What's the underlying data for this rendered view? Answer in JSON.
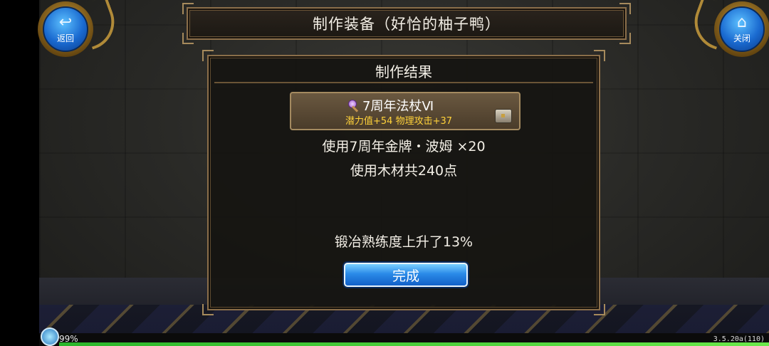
{
  "header": {
    "title": "制作装备（好恰的柚子鸭）",
    "back_label": "返回",
    "close_label": "关闭"
  },
  "panel": {
    "title": "制作结果",
    "item": {
      "name": "7周年法杖Ⅵ",
      "stats": "潜力值+54 物理攻击+37",
      "icon": "wand-icon",
      "side_icon": "chest-icon"
    },
    "material_line": "使用7周年金牌・波姆 ×20",
    "wood_line": "使用木材共240点",
    "skill_line": "锻冶熟练度上升了13%",
    "done_label": "完成"
  },
  "status": {
    "battery": "99%",
    "version": "3.5.20a(110)"
  },
  "colors": {
    "frame_gold": "#8a6e4a",
    "button_blue": "#2a8ae8",
    "stat_yellow": "#ffd23a"
  }
}
